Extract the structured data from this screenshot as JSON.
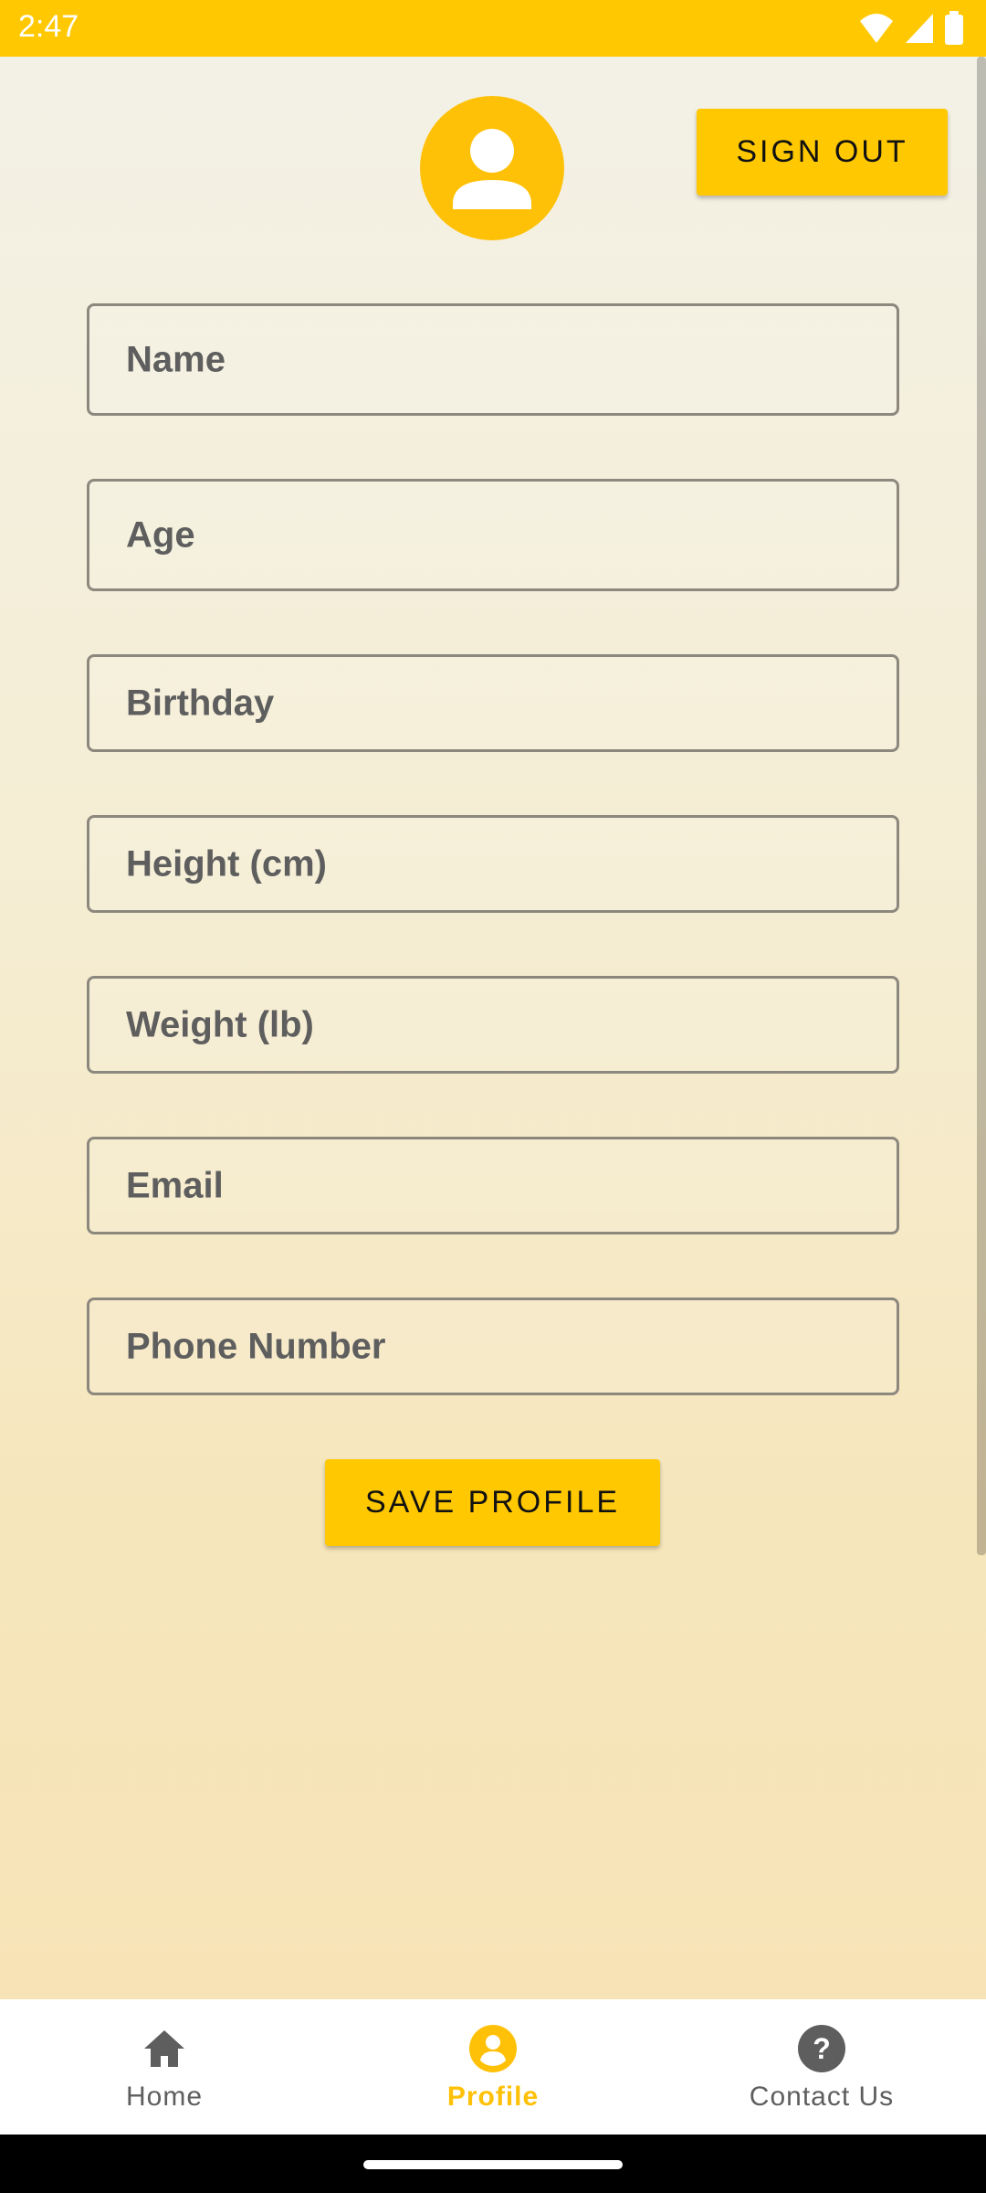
{
  "status_bar": {
    "time": "2:47",
    "icons": [
      "wifi-icon",
      "signal-icon",
      "battery-icon"
    ]
  },
  "profile": {
    "avatar_icon": "person-icon",
    "sign_out_label": "SIGN OUT",
    "fields": [
      {
        "placeholder": "Name",
        "value": ""
      },
      {
        "placeholder": "Age",
        "value": ""
      },
      {
        "placeholder": "Birthday",
        "value": ""
      },
      {
        "placeholder": "Height (cm)",
        "value": ""
      },
      {
        "placeholder": "Weight (lb)",
        "value": ""
      },
      {
        "placeholder": "Email",
        "value": ""
      },
      {
        "placeholder": "Phone Number",
        "value": ""
      }
    ],
    "save_label": "SAVE PROFILE"
  },
  "bottom_nav": {
    "items": [
      {
        "label": "Home",
        "icon": "home-icon",
        "active": false
      },
      {
        "label": "Profile",
        "icon": "account-circle-icon",
        "active": true
      },
      {
        "label": "Contact Us",
        "icon": "help-circle-icon",
        "active": false
      }
    ]
  },
  "colors": {
    "accent": "#FFC800",
    "active_nav": "#FFC107",
    "inactive_nav": "#5E5E5E"
  }
}
